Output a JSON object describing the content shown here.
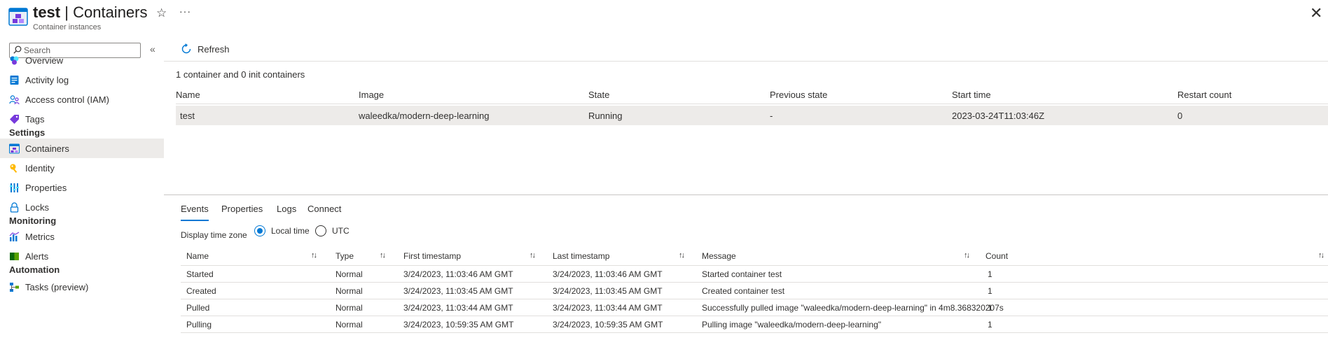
{
  "header": {
    "resource_name": "test",
    "separator": "|",
    "page_name": "Containers",
    "subtitle": "Container instances",
    "star_icon": "star-icon",
    "more_icon": "more-icon",
    "close_icon": "close-icon"
  },
  "sidebar": {
    "search_placeholder": "Search",
    "collapse_glyph": "«",
    "items": [
      {
        "label": "Overview",
        "icon": "overview-icon"
      },
      {
        "label": "Activity log",
        "icon": "activity-log-icon"
      },
      {
        "label": "Access control (IAM)",
        "icon": "iam-icon"
      },
      {
        "label": "Tags",
        "icon": "tag-icon"
      }
    ],
    "sections": [
      {
        "title": "Settings",
        "items": [
          {
            "label": "Containers",
            "icon": "containers-icon",
            "selected": true
          },
          {
            "label": "Identity",
            "icon": "identity-icon"
          },
          {
            "label": "Properties",
            "icon": "properties-icon"
          },
          {
            "label": "Locks",
            "icon": "lock-icon"
          }
        ]
      },
      {
        "title": "Monitoring",
        "items": [
          {
            "label": "Metrics",
            "icon": "metrics-icon"
          },
          {
            "label": "Alerts",
            "icon": "alerts-icon"
          }
        ]
      },
      {
        "title": "Automation",
        "items": [
          {
            "label": "Tasks (preview)",
            "icon": "tasks-icon"
          }
        ]
      }
    ]
  },
  "toolbar": {
    "refresh_label": "Refresh"
  },
  "containers": {
    "summary": "1 container and 0 init containers",
    "columns": [
      "Name",
      "Image",
      "State",
      "Previous state",
      "Start time",
      "Restart count"
    ],
    "rows": [
      [
        "test",
        "waleedka/modern-deep-learning",
        "Running",
        "-",
        "2023-03-24T11:03:46Z",
        "0"
      ]
    ]
  },
  "tabs": [
    {
      "label": "Events",
      "active": true
    },
    {
      "label": "Properties"
    },
    {
      "label": "Logs"
    },
    {
      "label": "Connect"
    }
  ],
  "timezone": {
    "label": "Display time zone",
    "options": [
      {
        "label": "Local time",
        "selected": true
      },
      {
        "label": "UTC",
        "selected": false
      }
    ]
  },
  "events": {
    "columns": [
      "Name",
      "Type",
      "First timestamp",
      "Last timestamp",
      "Message",
      "Count"
    ],
    "sort_glyph": "↑↓",
    "rows": [
      [
        "Started",
        "Normal",
        "3/24/2023, 11:03:46 AM GMT",
        "3/24/2023, 11:03:46 AM GMT",
        "Started container test",
        "1"
      ],
      [
        "Created",
        "Normal",
        "3/24/2023, 11:03:45 AM GMT",
        "3/24/2023, 11:03:45 AM GMT",
        "Created container test",
        "1"
      ],
      [
        "Pulled",
        "Normal",
        "3/24/2023, 11:03:44 AM GMT",
        "3/24/2023, 11:03:44 AM GMT",
        "Successfully pulled image \"waleedka/modern-deep-learning\" in 4m8.368320207s",
        "1"
      ],
      [
        "Pulling",
        "Normal",
        "3/24/2023, 10:59:35 AM GMT",
        "3/24/2023, 10:59:35 AM GMT",
        "Pulling image \"waleedka/modern-deep-learning\"",
        "1"
      ]
    ]
  },
  "colors": {
    "accent": "#0078d4",
    "selected_row": "#edebe9",
    "border": "#e1dfdd"
  }
}
